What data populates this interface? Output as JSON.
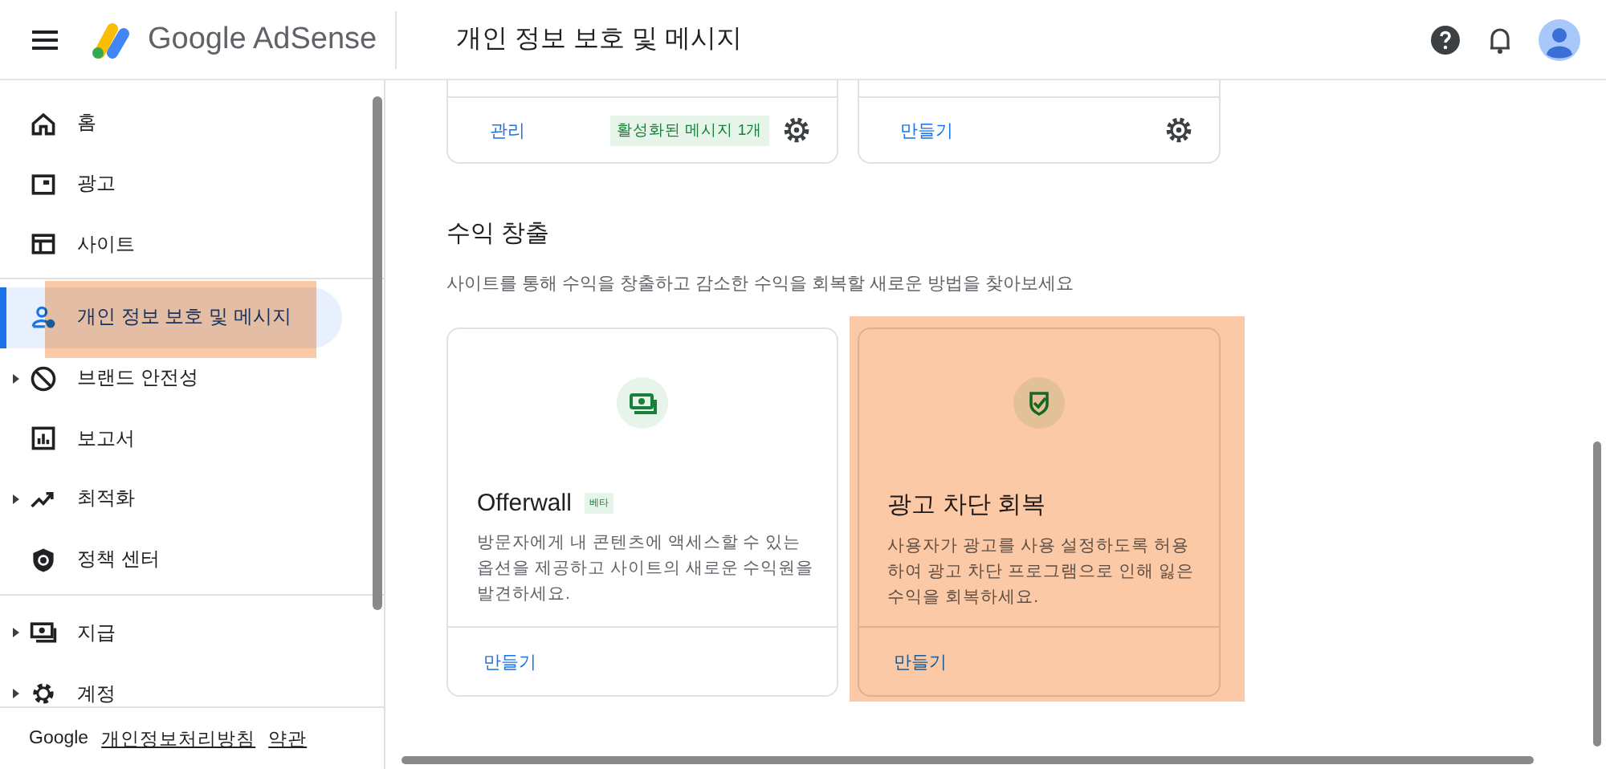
{
  "header": {
    "product": "Google AdSense",
    "page_title": "개인 정보 보호 및 메시지"
  },
  "sidebar": {
    "groups": [
      {
        "items": [
          {
            "label": "홈",
            "expandable": false,
            "selected": false,
            "highlighted": false
          },
          {
            "label": "광고",
            "expandable": false,
            "selected": false,
            "highlighted": false
          },
          {
            "label": "사이트",
            "expandable": false,
            "selected": false,
            "highlighted": false
          }
        ]
      },
      {
        "items": [
          {
            "label": "개인 정보 보호 및 메시지",
            "expandable": false,
            "selected": true,
            "highlighted": true
          },
          {
            "label": "브랜드 안전성",
            "expandable": true,
            "selected": false,
            "highlighted": false
          },
          {
            "label": "보고서",
            "expandable": false,
            "selected": false,
            "highlighted": false
          },
          {
            "label": "최적화",
            "expandable": true,
            "selected": false,
            "highlighted": false
          },
          {
            "label": "정책 센터",
            "expandable": false,
            "selected": false,
            "highlighted": false
          }
        ]
      },
      {
        "items": [
          {
            "label": "지급",
            "expandable": true,
            "selected": false,
            "highlighted": false
          },
          {
            "label": "계정",
            "expandable": true,
            "selected": false,
            "highlighted": false
          }
        ]
      }
    ],
    "footer": {
      "brand": "Google",
      "links": [
        "개인정보처리방침",
        "약관"
      ]
    }
  },
  "top_cards": [
    {
      "action": "관리",
      "badge": "활성화된 메시지 1개"
    },
    {
      "action": "만들기"
    }
  ],
  "section": {
    "title": "수익 창출",
    "subtitle": "사이트를 통해 수익을 창출하고 감소한 수익을 회복할 새로운 방법을 찾아보세요"
  },
  "cards": [
    {
      "title": "Offerwall",
      "tag": "베타",
      "description": "방문자에게 내 콘텐츠에 액세스할 수 있는 옵션을 제공하고 사이트의 새로운 수익원을 발견하세요.",
      "action": "만들기",
      "highlighted": false
    },
    {
      "title": "광고 차단 회복",
      "description": "사용자가 광고를 사용 설정하도록 허용하여 광고 차단 프로그램으로 인해 잃은 수익을 회복하세요.",
      "action": "만들기",
      "highlighted": true
    }
  ]
}
